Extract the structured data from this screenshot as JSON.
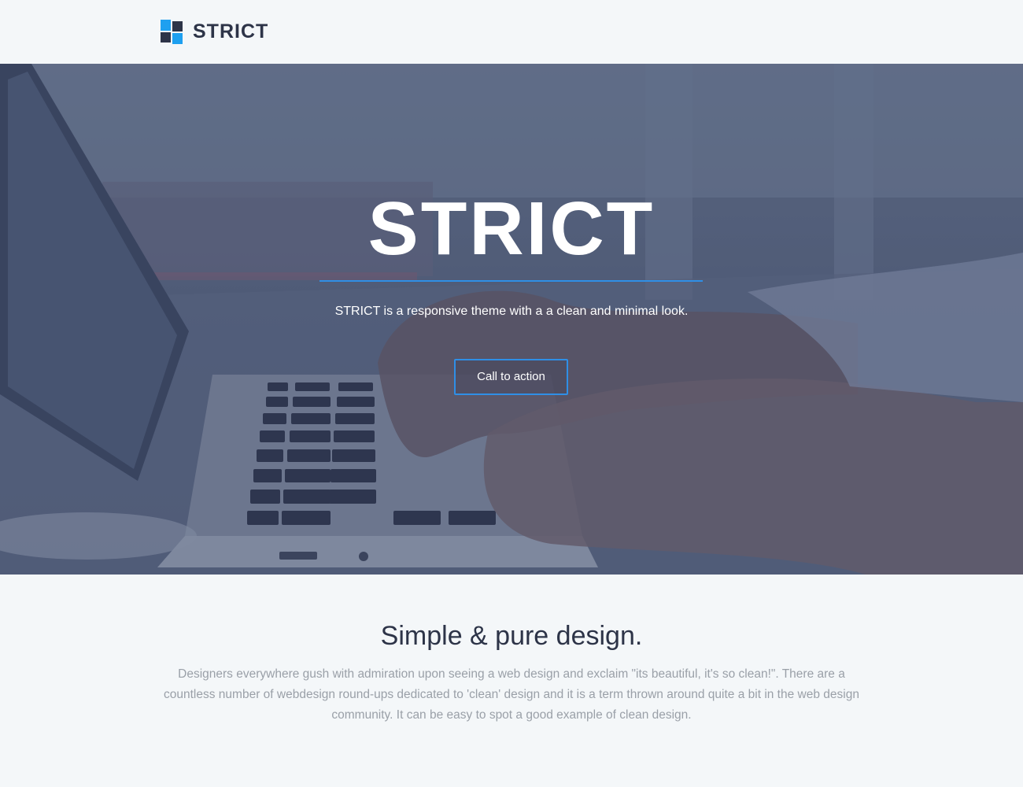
{
  "header": {
    "brand_name": "STRICT",
    "logo_icon": "four-squares-logo-icon"
  },
  "hero": {
    "title": "STRICT",
    "subtitle": "STRICT is a responsive theme with a a clean and minimal look.",
    "cta_label": "Call to action",
    "background_image": "laptop-typing-photo"
  },
  "section": {
    "title": "Simple & pure design.",
    "body": "Designers everywhere gush with admiration upon seeing a web design and exclaim \"its beautiful, it's so clean!\". There are a countless number of webdesign round-ups dedicated to 'clean' design and it is a term thrown around quite a bit in the web design community. It can be easy to spot a good example of clean design."
  },
  "colors": {
    "accent_blue": "#2f8fe6",
    "logo_light_blue": "#1ea0f0",
    "logo_dark": "#2d3448",
    "heading_dark": "#2d3448",
    "body_gray": "#9aa0a8",
    "page_background": "#f4f7f9"
  }
}
